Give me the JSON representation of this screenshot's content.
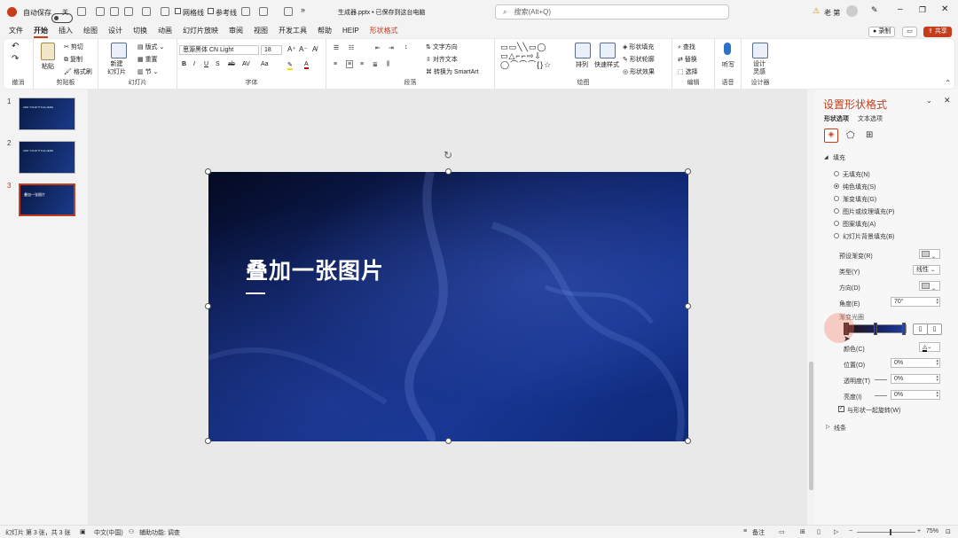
{
  "titlebar": {
    "autosave_label": "自动保存",
    "autosave_state": "关",
    "check_grid": "网格线",
    "check_guides": "参考线",
    "filename": "生成器.pptx • 已保存到这台电脑",
    "search_placeholder": "搜索(Alt+Q)",
    "user_name": "老 第"
  },
  "tabs": [
    "文件",
    "开始",
    "插入",
    "绘图",
    "设计",
    "切换",
    "动画",
    "幻灯片放映",
    "审阅",
    "视图",
    "开发工具",
    "帮助",
    "HEIP",
    "形状格式"
  ],
  "active_tab": "开始",
  "record_label": "录制",
  "share_label": "共享",
  "ribbon": {
    "undo": {
      "label": "撤消"
    },
    "clipboard": {
      "label": "剪贴板",
      "paste": "粘贴",
      "cut": "剪切",
      "copy": "复制",
      "format_painter": "格式刷"
    },
    "slides": {
      "label": "幻灯片",
      "new_slide": "新建\n幻灯片",
      "layout": "版式",
      "reset": "重置",
      "section": "节"
    },
    "font": {
      "label": "字体",
      "font_name": "思源黑体 CN Light",
      "font_size": "18"
    },
    "paragraph": {
      "label": "段落",
      "text_direction": "文字方向",
      "align_text": "对齐文本",
      "smartart": "转换为 SmartArt"
    },
    "drawing": {
      "label": "绘图",
      "arrange": "排列",
      "quick_styles": "快速样式",
      "shape_fill": "形状填充",
      "shape_outline": "形状轮廓",
      "shape_effects": "形状效果"
    },
    "editing": {
      "label": "编辑",
      "find": "查找",
      "replace": "替换",
      "select": "选择"
    },
    "voice": {
      "label": "语音",
      "dictate": "听写"
    },
    "designer": {
      "label": "设计器",
      "designer": "设计\n灵感"
    }
  },
  "thumbnails": [
    {
      "num": "1",
      "title": "ADD YOUR TITLE HERE"
    },
    {
      "num": "2",
      "title": "ADD YOUR TITLE HERE"
    },
    {
      "num": "3",
      "title": "叠加一张图片"
    }
  ],
  "slide": {
    "title": "叠加一张图片"
  },
  "pane": {
    "title": "设置形状格式",
    "tab_shape": "形状选项",
    "tab_text": "文本选项",
    "section_fill": "填充",
    "fill_options": [
      "无填充(N)",
      "纯色填充(S)",
      "渐变填充(G)",
      "图片或纹理填充(P)",
      "图案填充(A)",
      "幻灯片背景填充(B)"
    ],
    "fill_selected": 1,
    "preset_gradient": "预设渐变(R)",
    "type_label": "类型(Y)",
    "type_value": "线性",
    "direction_label": "方向(D)",
    "angle_label": "角度(E)",
    "angle_value": "70°",
    "gradient_stops": "渐变光圈",
    "color_label": "颜色(C)",
    "position_label": "位置(O)",
    "position_value": "0%",
    "transparency_label": "透明度(T)",
    "transparency_value": "0%",
    "brightness_label": "亮度(I)",
    "brightness_value": "0%",
    "rotate_with_shape": "与形状一起旋转(W)",
    "section_line": "线条"
  },
  "status": {
    "slide_info": "幻灯片 第 3 张，共 3 张",
    "language": "中文(中国)",
    "accessibility": "辅助功能: 调查",
    "notes": "备注",
    "zoom": "75%"
  }
}
